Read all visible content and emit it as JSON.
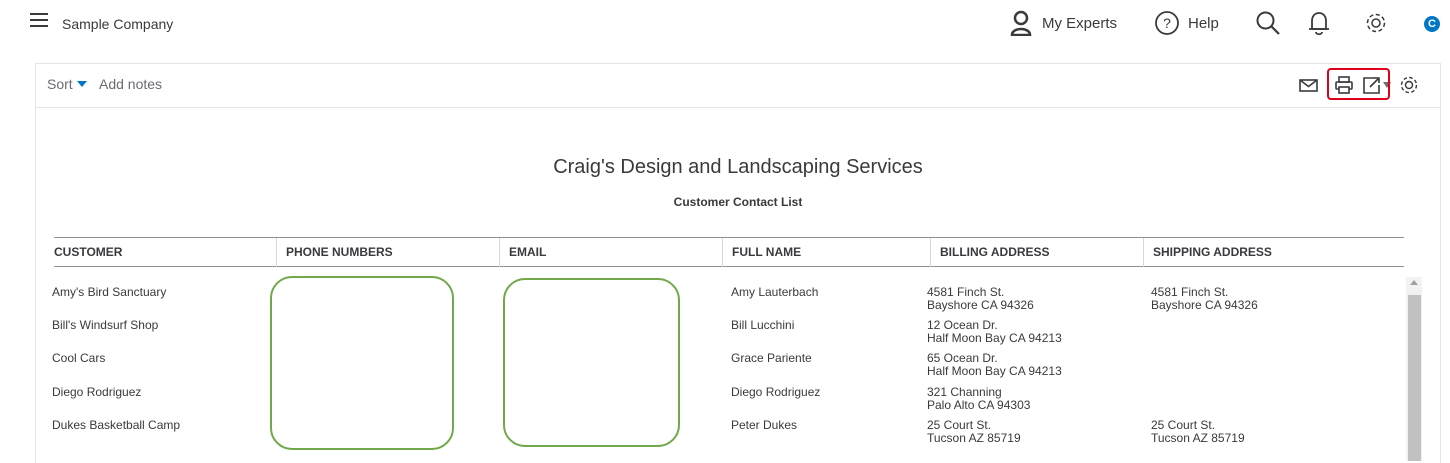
{
  "header": {
    "company_name": "Sample Company",
    "my_experts_label": "My Experts",
    "help_label": "Help",
    "avatar_initial": "C",
    "accent_color": "#0077c5"
  },
  "toolbar": {
    "sort_label": "Sort",
    "add_notes_label": "Add notes",
    "icons": [
      "email-icon",
      "print-icon",
      "export-icon",
      "settings-icon"
    ],
    "highlight_color": "#e0001b"
  },
  "report": {
    "company": "Craig's Design and Landscaping Services",
    "title": "Customer Contact List",
    "columns": [
      "CUSTOMER",
      "PHONE NUMBERS",
      "EMAIL",
      "FULL NAME",
      "BILLING ADDRESS",
      "SHIPPING ADDRESS"
    ],
    "rows": [
      {
        "customer": "Amy's Bird Sanctuary",
        "full_name": "Amy Lauterbach",
        "billing_1": "4581 Finch St.",
        "billing_2": "Bayshore CA 94326",
        "shipping_1": "4581 Finch St.",
        "shipping_2": "Bayshore CA 94326"
      },
      {
        "customer": "Bill's Windsurf Shop",
        "full_name": "Bill Lucchini",
        "billing_1": "12 Ocean Dr.",
        "billing_2": "Half Moon Bay CA 94213",
        "shipping_1": "",
        "shipping_2": ""
      },
      {
        "customer": "Cool Cars",
        "full_name": "Grace Pariente",
        "billing_1": "65 Ocean Dr.",
        "billing_2": "Half Moon Bay CA 94213",
        "shipping_1": "",
        "shipping_2": ""
      },
      {
        "customer": "Diego Rodriguez",
        "full_name": "Diego Rodriguez",
        "billing_1": "321 Channing",
        "billing_2": "Palo Alto CA 94303",
        "shipping_1": "",
        "shipping_2": ""
      },
      {
        "customer": "Dukes Basketball Camp",
        "full_name": "Peter Dukes",
        "billing_1": "25 Court St.",
        "billing_2": "Tucson AZ 85719",
        "shipping_1": "25 Court St.",
        "shipping_2": "Tucson AZ 85719"
      }
    ],
    "redaction_color": "#71a84a"
  }
}
